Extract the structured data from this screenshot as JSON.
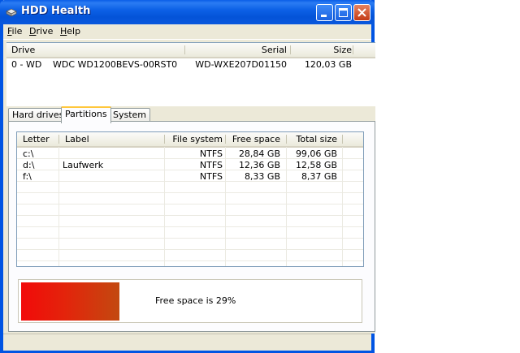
{
  "window": {
    "title": "HDD Health"
  },
  "menu": [
    {
      "pre": "",
      "u": "F",
      "post": "ile"
    },
    {
      "pre": "",
      "u": "D",
      "post": "rive"
    },
    {
      "pre": "",
      "u": "H",
      "post": "elp"
    }
  ],
  "drives": {
    "columns": {
      "drive": "Drive",
      "serial": "Serial",
      "size": "Size"
    },
    "rows": [
      {
        "id": "0 - WD",
        "model": "WDC WD1200BEVS-00RST0",
        "serial": "WD-WXE207D01150",
        "size": "120,03 GB"
      }
    ]
  },
  "tabs": [
    "Hard drives",
    "Partitions",
    "System"
  ],
  "active_tab": "Partitions",
  "partitions": {
    "columns": {
      "letter": "Letter",
      "label": "Label",
      "fs": "File system",
      "free": "Free space",
      "total": "Total size"
    },
    "rows": [
      {
        "letter": "c:\\",
        "label": "",
        "fs": "NTFS",
        "free": "28,84 GB",
        "total": "99,06 GB"
      },
      {
        "letter": "d:\\",
        "label": "Laufwerk",
        "fs": "NTFS",
        "free": "12,36 GB",
        "total": "12,58 GB"
      },
      {
        "letter": "f:\\",
        "label": "",
        "fs": "NTFS",
        "free": "8,33 GB",
        "total": "8,37 GB"
      }
    ]
  },
  "free_space": {
    "text": "Free space is 29%",
    "percent": 29
  },
  "colors": {
    "title_bar": "#0054e3",
    "active_tab_accent": "#ffc73c",
    "bar_start": "#f20a0a",
    "bar_end": "#c34910"
  }
}
